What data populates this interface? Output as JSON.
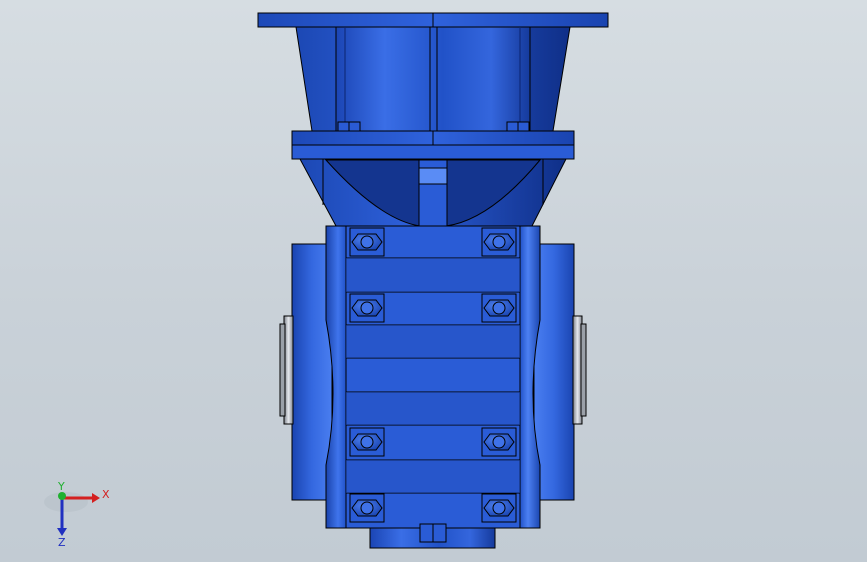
{
  "viewport": {
    "background_top": "#d6dde2",
    "background_bottom": "#c2cbd3"
  },
  "model": {
    "body_color": "#2456d0",
    "body_dark": "#0f2f8a",
    "body_light": "#4c7fef",
    "edge_color": "#000000",
    "seal_color": "#c8ccd2"
  },
  "triad": {
    "x_label": "X",
    "y_label": "Y",
    "z_label": "Z",
    "x_color": "#d42020",
    "y_color": "#20b030",
    "z_color": "#2030c0"
  }
}
